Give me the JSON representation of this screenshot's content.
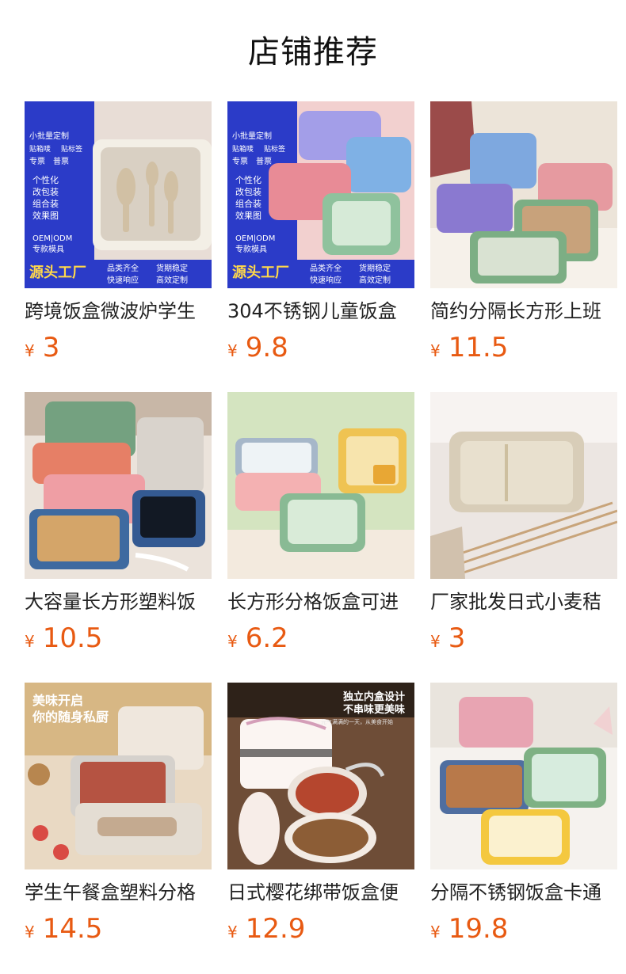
{
  "page": {
    "title": "店铺推荐"
  },
  "products": [
    {
      "title": "跨境饭盒微波炉学生",
      "currency": "¥",
      "price": "3",
      "badges": [
        "小批量定制",
        "贴箱唛",
        "贴标签",
        "专票",
        "普票",
        "个性化",
        "改包装",
        "组合装",
        "效果图",
        "OEM|ODM",
        "专款模具",
        "源头工厂",
        "品类齐全",
        "货期稳定",
        "快速响应",
        "高效定制"
      ]
    },
    {
      "title": "304不锈钢儿童饭盒",
      "currency": "¥",
      "price": "9.8",
      "badges": [
        "小批量定制",
        "贴箱唛",
        "贴标签",
        "专票",
        "普票",
        "个性化",
        "改包装",
        "组合装",
        "效果图",
        "OEM|ODM",
        "专款模具",
        "源头工厂",
        "品类齐全",
        "货期稳定",
        "快速响应",
        "高效定制"
      ]
    },
    {
      "title": "简约分隔长方形上班",
      "currency": "¥",
      "price": "11.5"
    },
    {
      "title": "大容量长方形塑料饭",
      "currency": "¥",
      "price": "10.5"
    },
    {
      "title": "长方形分格饭盒可进",
      "currency": "¥",
      "price": "6.2"
    },
    {
      "title": "厂家批发日式小麦秸",
      "currency": "¥",
      "price": "3"
    },
    {
      "title": "学生午餐盒塑料分格",
      "currency": "¥",
      "price": "14.5",
      "badges": [
        "美味开启",
        "你的随身私厨"
      ]
    },
    {
      "title": "日式樱花绑带饭盒便",
      "currency": "¥",
      "price": "12.9",
      "badges": [
        "独立内盒设计",
        "不串味更美味",
        "元气满满的一天，从美食开始"
      ]
    },
    {
      "title": "分隔不锈钢饭盒卡通",
      "currency": "¥",
      "price": "19.8"
    }
  ]
}
